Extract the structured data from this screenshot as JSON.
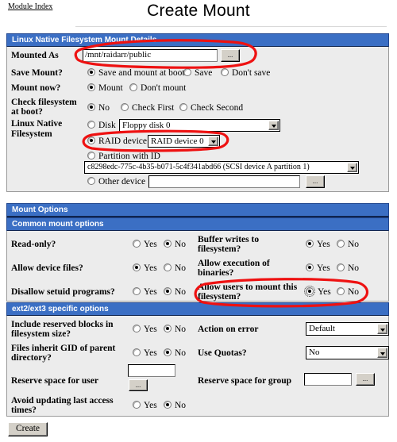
{
  "header": {
    "module_index": "Module Index",
    "title": "Create Mount"
  },
  "sections": {
    "mount_details_title": "Linux Native Filesystem Mount Details",
    "mount_options_title": "Mount Options",
    "common_options_title": "Common mount options",
    "ext_options_title": "ext2/ext3 specific options"
  },
  "mount_details": {
    "mounted_as_label": "Mounted As",
    "mounted_as_value": "/mnt/raidarr/public",
    "mounted_as_browse": "...",
    "save_mount_label": "Save Mount?",
    "save_mount_options": [
      "Save and mount at boot",
      "Save",
      "Don't save"
    ],
    "save_mount_selected": 0,
    "mount_now_label": "Mount now?",
    "mount_now_options": [
      "Mount",
      "Don't mount"
    ],
    "mount_now_selected": 0,
    "check_fs_label_line1": "Check filesystem",
    "check_fs_label_line2": "at boot?",
    "check_fs_options": [
      "No",
      "Check First",
      "Check Second"
    ],
    "check_fs_selected": 0,
    "fs_label_line1": "Linux Native",
    "fs_label_line2": "Filesystem",
    "device_disk_label": "Disk",
    "device_disk_value": "Floppy disk 0",
    "device_raid_label": "RAID device",
    "device_raid_value": "RAID device 0",
    "device_partition_label": "Partition with ID",
    "device_partition_value": "c8298edc-775c-4b35-b071-5c4f341abd66 (SCSI device A partition 1)",
    "device_other_label": "Other device",
    "device_other_value": "",
    "device_other_browse": "...",
    "device_selected": "raid"
  },
  "common_options": {
    "yes": "Yes",
    "no": "No",
    "rows": [
      {
        "label": "Read-only?",
        "selected": "no"
      },
      {
        "label": "Allow device files?",
        "selected": "yes"
      },
      {
        "label": "Disallow setuid programs?",
        "selected": "no"
      }
    ],
    "rows_right": [
      {
        "label_line1": "Buffer writes to",
        "label_line2": "filesystem?",
        "selected": "yes",
        "focused": false
      },
      {
        "label_line1": "Allow execution of",
        "label_line2": "binaries?",
        "selected": "yes",
        "focused": false
      },
      {
        "label_line1": "Allow users to mount this",
        "label_line2": "filesystem?",
        "selected": "yes",
        "focused": true
      }
    ]
  },
  "ext_options": {
    "yes": "Yes",
    "no": "No",
    "reserved_blocks_line1": "Include reserved blocks in",
    "reserved_blocks_line2": "filesystem size?",
    "reserved_blocks_selected": "no",
    "inherit_gid_line1": "Files inherit GID of parent",
    "inherit_gid_line2": "directory?",
    "inherit_gid_selected": "no",
    "action_on_error_label": "Action on error",
    "action_on_error_value": "Default",
    "use_quotas_label": "Use Quotas?",
    "use_quotas_value": "No",
    "reserve_user_label": "Reserve space for user",
    "reserve_user_value": "",
    "reserve_user_browse": "...",
    "reserve_group_label": "Reserve space for group",
    "reserve_group_value": "",
    "reserve_group_browse": "...",
    "avoid_atime_line1": "Avoid updating last access",
    "avoid_atime_line2": "times?",
    "avoid_atime_selected": "no"
  },
  "footer": {
    "create_label": "Create"
  },
  "annotations": {
    "color": "#ee1111",
    "ellipse_mounted_as": "highlight-mounted-as-field",
    "ellipse_raid_device": "highlight-raid-device-option",
    "ellipse_allow_users": "highlight-allow-users-to-mount-option"
  }
}
